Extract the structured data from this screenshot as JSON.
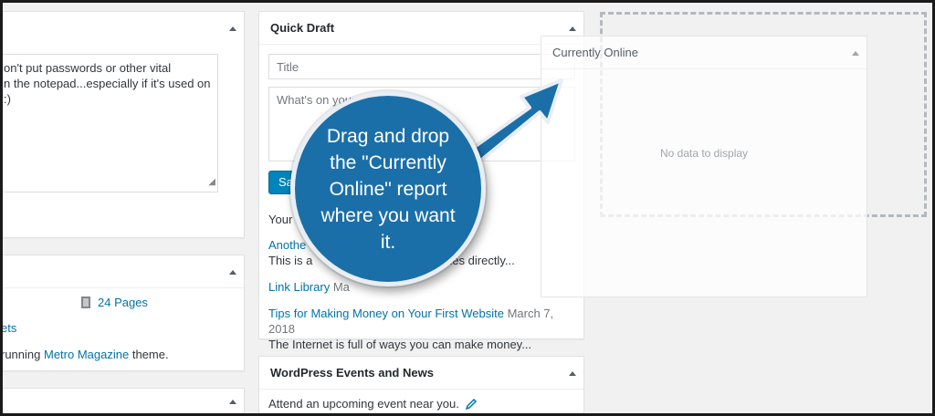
{
  "notes": {
    "text": "on't put passwords or other vital\nn the notepad...especially if it's used on\n:)"
  },
  "glance": {
    "pages": "24 Pages",
    "posts": "ets",
    "theme_prefix": "running",
    "theme_name": "Metro Magazine",
    "theme_suffix": "theme."
  },
  "quick_draft": {
    "title": "Quick Draft",
    "title_placeholder": "Title",
    "content_placeholder": "What's on your mi",
    "save_label": "Sa",
    "recent_label": "Your",
    "drafts": [
      {
        "title": "Anothe",
        "date": "",
        "excerpt": "This is a",
        "excerpt_tail": "les directly..."
      },
      {
        "title": "Link Library",
        "date": "Ma",
        "excerpt": ""
      },
      {
        "title": "Tips for Making Money on Your First Website",
        "date": "March 7, 2018",
        "excerpt": "The Internet is full of ways you can make money..."
      }
    ]
  },
  "events": {
    "title": "WordPress Events and News",
    "body": "Attend an upcoming event near you."
  },
  "currently_online": {
    "title": "Currently Online",
    "empty": "No data to display"
  },
  "callout": {
    "text": "Drag and drop the \"Currently Online\" report where you want it."
  },
  "colors": {
    "accent": "#0073aa",
    "callout_blue": "#1b6fa8",
    "button": "#0085ba"
  },
  "icons": [
    "toggle-arrow-icon",
    "pages-icon",
    "pencil-icon",
    "resize-grip-icon",
    "callout-arrow-icon"
  ]
}
